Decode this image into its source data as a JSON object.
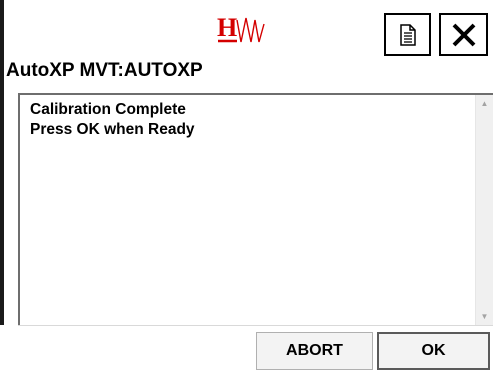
{
  "header": {
    "logo_icon": "hw-logo-icon",
    "notes_icon": "document-icon",
    "close_icon": "close-icon",
    "logo_color": "#d40000"
  },
  "title": "AutoXP MVT:AUTOXP",
  "message": {
    "lines": [
      "Calibration Complete",
      "Press OK when Ready"
    ]
  },
  "buttons": {
    "abort_label": "ABORT",
    "ok_label": "OK"
  }
}
